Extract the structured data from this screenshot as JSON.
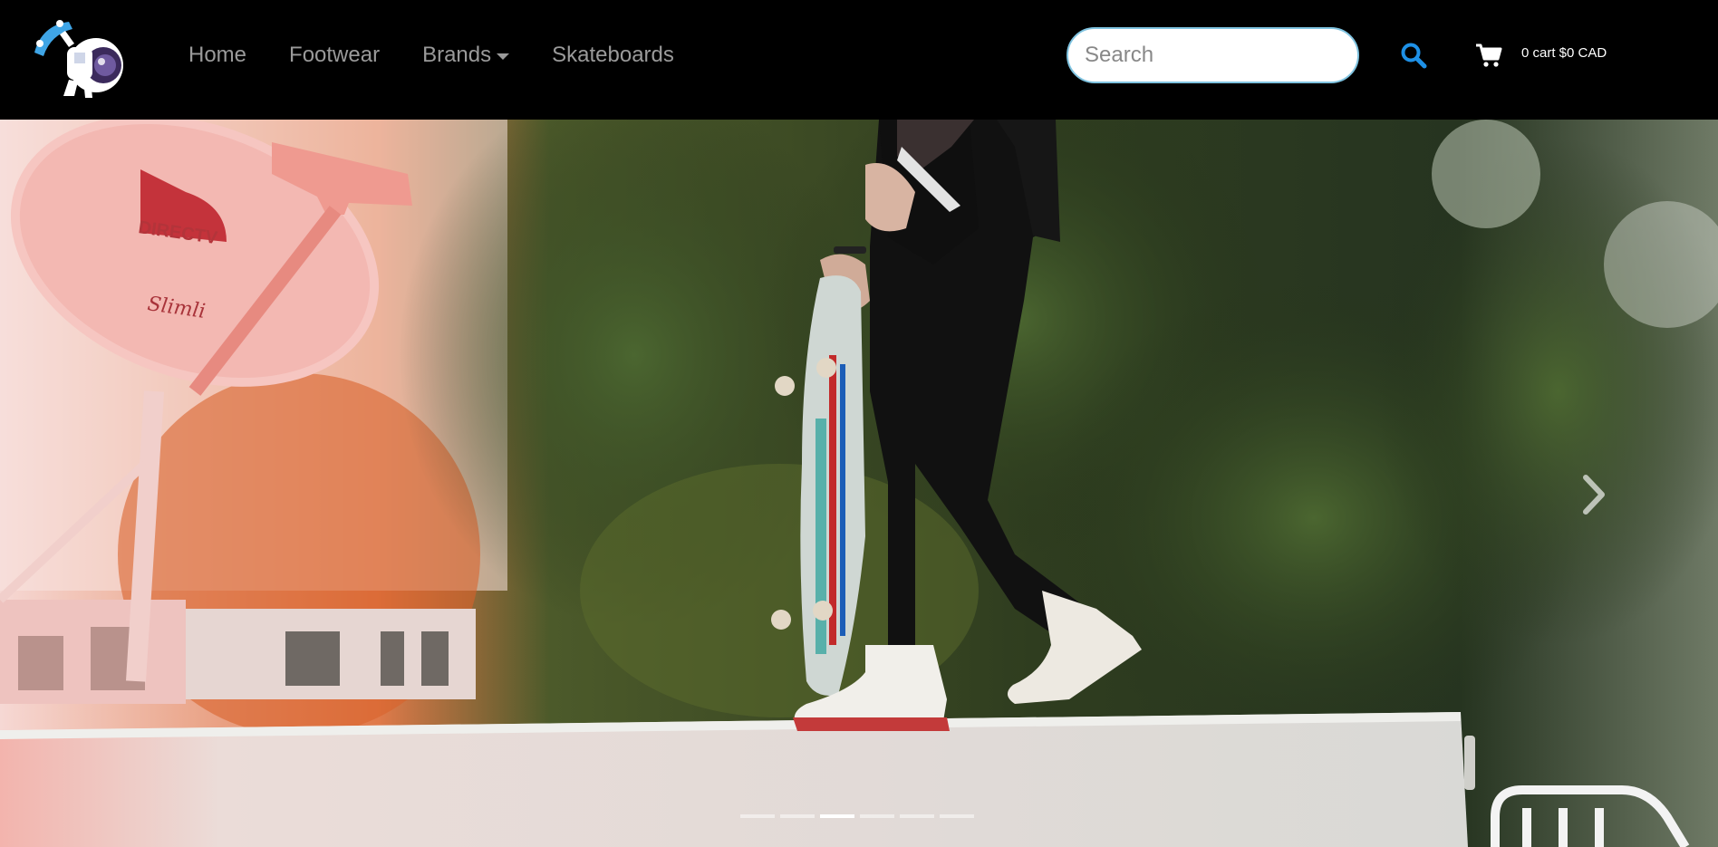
{
  "nav": {
    "links": [
      {
        "label": "Home"
      },
      {
        "label": "Footwear"
      },
      {
        "label": "Brands"
      },
      {
        "label": "Skateboards"
      }
    ],
    "search": {
      "placeholder": "Search"
    },
    "cart": {
      "label": "0 cart $0 CAD"
    },
    "icons": {
      "logo": "astronaut-skater-logo",
      "search": "search-icon",
      "cart": "cart-icon"
    },
    "colors": {
      "accent": "#1e90e6",
      "background": "#000000"
    }
  },
  "carousel": {
    "slide_count": 6,
    "active_index": 2,
    "hero_text": {
      "dish_brand": "DIRECTV",
      "dish_script": "Slimli"
    }
  }
}
